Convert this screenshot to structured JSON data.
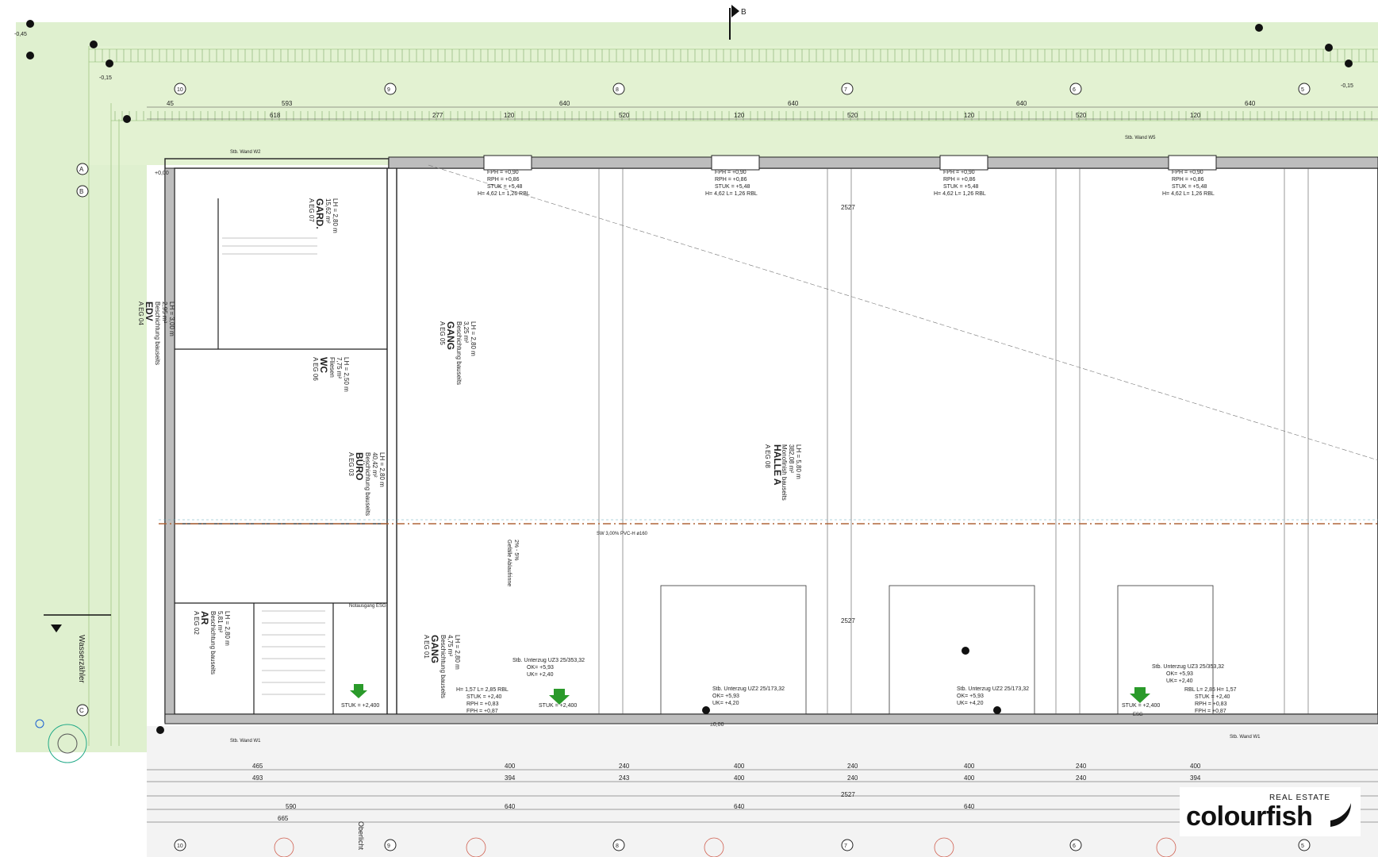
{
  "section_marker": "B",
  "rooms": [
    {
      "code": "A EG 07",
      "name": "GARD.",
      "area": "15,62 m²",
      "lh": "LH = 2,80 m"
    },
    {
      "code": "A EG 05",
      "name": "GANG",
      "line": "Beschichtung bauseits",
      "area": "3,25 m²",
      "lh": "LH = 2,80 m"
    },
    {
      "code": "A EG 04",
      "name": "EDV",
      "line": "Beschichtung bauseits",
      "area": "2,95 m²",
      "lh": "LH = 3,00 m"
    },
    {
      "code": "A EG 06",
      "name": "WC",
      "line": "Fliesen",
      "area": "7,75 m²",
      "lh": "LH = 2,50 m"
    },
    {
      "code": "A EG 03",
      "name": "BÜRO",
      "line": "Beschichtung bauseits",
      "area": "40,42 m²",
      "lh": "LH = 2,80 m"
    },
    {
      "code": "A EG 08",
      "name": "HALLE A",
      "line": "Monofinish bauseits",
      "area": "382,08 m²",
      "lh": "LH = 5,80 m"
    },
    {
      "code": "A EG 02",
      "name": "AR",
      "line": "Beschichtung bauseits",
      "area": "5,81 m²",
      "lh": "LH = 2,80 m"
    },
    {
      "code": "A EG 01",
      "name": "GANG",
      "line": "Beschichtung bauseits",
      "area": "4,75 m²",
      "lh": "LH = 2,80 m"
    }
  ],
  "window_labels": {
    "fph": "FPH = +0,90",
    "rph": "RPH = +0,86",
    "stuk": "STUK = +5,48",
    "hl": "H= 4,62  L= 1,26  RBL"
  },
  "door_labels": {
    "left": [
      "H= 1,57  L= 2,85  RBL",
      "STUK = +2,40",
      "RPH = +0,83",
      "FPH = +0,87"
    ],
    "right": [
      "RBL  L= 2,85  H= 1,57",
      "STUK = +2,40",
      "RPH = +0,83",
      "FPH = +0,87"
    ]
  },
  "beams": {
    "uz3": [
      "Stb. Unterzug UZ3 25/353,32",
      "OK= +5,93",
      "UK= +2,40"
    ],
    "uz2": [
      "Stb. Unterzug UZ2 25/173,32",
      "OK= +5,93",
      "UK= +4,20"
    ]
  },
  "stuk_2400": "STUK = +2,400",
  "slope_label": "Gefälle Ablaufrinne",
  "slope_pct": "2% - 5%",
  "sw_label": "SW 3,00% PVC-H   ø160",
  "wall_w1": "Stb. Wand W1",
  "wall_w2": "Stb. Wand W2",
  "wall_w5": "Stb. Wand W5",
  "wasserzaehler": "Wasserzähler",
  "oberlicht": "Oberlicht",
  "notaustritt": "Notausgang ESG",
  "esg": "ESG",
  "span_2527": "2527",
  "top_dims": [
    "45",
    "593",
    "640",
    "640",
    "640",
    "640"
  ],
  "row2_dims": [
    "618",
    "277",
    "120",
    "520",
    "120",
    "520",
    "120",
    "520",
    "120"
  ],
  "bot_dims_1": [
    "465",
    "400",
    "240",
    "400",
    "240",
    "400",
    "240",
    "400"
  ],
  "bot_dims_2": [
    "493",
    "394",
    "243",
    "400",
    "240",
    "400",
    "240",
    "394"
  ],
  "bot_dims_3": [
    "590",
    "640",
    "640",
    "640"
  ],
  "bot_dims_4": [
    "665"
  ],
  "axis_numbers": [
    "10",
    "9",
    "8",
    "7",
    "6",
    "5"
  ],
  "axis_letters": [
    "A",
    "B",
    "C"
  ],
  "levels": [
    "-0,45",
    "-0,15",
    "-0,15",
    "+0,00",
    "±0,00"
  ],
  "logo_tag": "REAL ESTATE",
  "logo_brand": "colourfish"
}
